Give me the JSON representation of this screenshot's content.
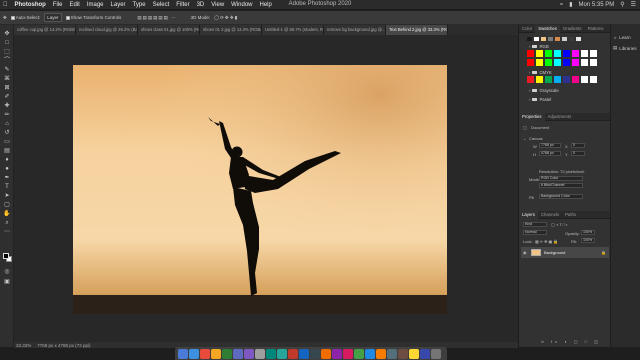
{
  "menubar": {
    "app": "Photoshop",
    "items": [
      "File",
      "Edit",
      "Image",
      "Layer",
      "Type",
      "Select",
      "Filter",
      "3D",
      "View",
      "Window",
      "Help"
    ],
    "window_title": "Adobe Photoshop 2020",
    "clock": "Mon 5:35 PM"
  },
  "options": {
    "auto_select": "Auto-Select:",
    "layer": "Layer",
    "show_transform": "Show Transform Controls",
    "mode_3d": "3D Mode:"
  },
  "tabs": [
    {
      "label": "coffee cup.jpg @ 14.2% (RGB/8#)"
    },
    {
      "label": "reclined cloud.jpg @ 26.2% (Back..."
    },
    {
      "label": "shoes class 01.jpg @ 100% (RG..."
    },
    {
      "label": "shoes 01 2.jpg @ 13.3% (RGB/8..."
    },
    {
      "label": "Untitled-1 @ 66.7% (student, R..."
    },
    {
      "label": "remove bg background.jpg @..."
    },
    {
      "label": "Text Behind 2.jpg @ 33.3% (RGB/8)",
      "active": true
    }
  ],
  "status": {
    "zoom": "33.33%",
    "doc": "7768 px x 4788 px (72 ppi)"
  },
  "color_panel": {
    "tabs": [
      "Color",
      "Swatches",
      "Gradients",
      "Patterns"
    ],
    "groups": [
      "RGB",
      "CMYK",
      "Grayscale",
      "Pastel"
    ],
    "swatch_colors": [
      "#ff0000",
      "#ffff00",
      "#00ff00",
      "#00ffff",
      "#0000ff",
      "#ff00ff",
      "#ffffff",
      "#ffffff"
    ],
    "cmyk_colors": [
      "#ed1c24",
      "#fff200",
      "#00a651",
      "#00aeef",
      "#2e3192",
      "#ec008c",
      "#ffffff",
      "#ffffff"
    ]
  },
  "properties": {
    "tabs": [
      "Properties",
      "Adjustments"
    ],
    "section": "Document",
    "canvas": "Canvas",
    "w": "7768 px",
    "h": "4788 px",
    "x": "0",
    "y": "0",
    "resolution": "Resolution: 72 pixels/inch",
    "mode_label": "Mode",
    "mode": "RGB Color",
    "depth": "8 Bits/Channel",
    "fill_label": "Fill",
    "fill": "Background Color"
  },
  "layers": {
    "tabs": [
      "Layers",
      "Channels",
      "Paths"
    ],
    "kind": "Kind",
    "blend": "Normal",
    "opacity_label": "Opacity:",
    "opacity": "100%",
    "lock": "Lock:",
    "fill_label": "Fill:",
    "fill": "100%",
    "items": [
      {
        "name": "Background"
      }
    ]
  },
  "right_col": {
    "items": [
      "Learn",
      "Libraries"
    ]
  }
}
